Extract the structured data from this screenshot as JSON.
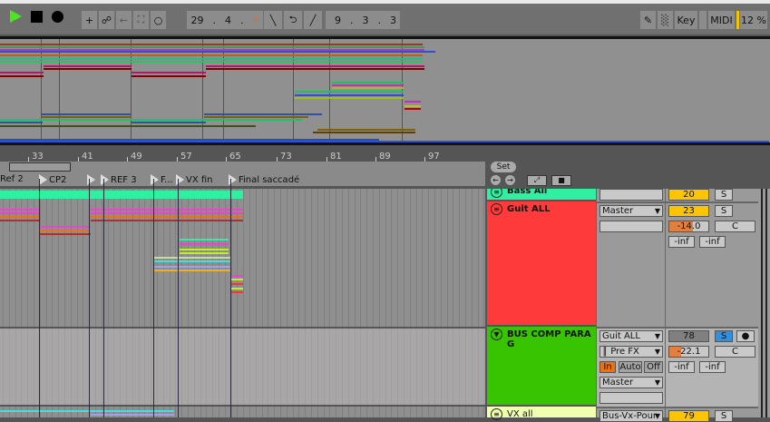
{
  "transport": {
    "play": "play-icon",
    "stop": "stop-icon",
    "record": "record-icon"
  },
  "position": {
    "bar": "29",
    "beat": "4",
    "sixteenth": "4"
  },
  "loop_length": {
    "bar": "9",
    "beat": "3",
    "sixteenth": "3"
  },
  "right_toolbar": {
    "key": "Key",
    "midi": "MIDI",
    "cpu": "12 %"
  },
  "ruler": {
    "bars": [
      "33",
      "41",
      "49",
      "57",
      "65",
      "73",
      "81",
      "89",
      "97"
    ]
  },
  "locators": [
    "Ref 2",
    "CP2",
    "",
    "REF 3",
    "F...",
    "VX fin",
    "Final saccadé"
  ],
  "set_panel": {
    "set": "Set"
  },
  "tracks": [
    {
      "name": "Bass All",
      "color": "#2ef0a0",
      "volume": "20",
      "solo": "S"
    },
    {
      "name": "Guit ALL",
      "color": "#ff3a3a",
      "output": "Master",
      "volume": "23",
      "solo": "S",
      "send": "-14.0",
      "pan": "C",
      "peak_l": "-inf",
      "peak_r": "-inf"
    },
    {
      "name": "BUS COMP PARA G",
      "color": "#38c400",
      "input": "Guit ALL",
      "input_ch": "Pre FX",
      "monitor": [
        "In",
        "Auto",
        "Off"
      ],
      "output": "Master",
      "volume": "78",
      "solo": "S",
      "send": "-22.1",
      "pan": "C",
      "peak_l": "-inf",
      "peak_r": "-inf"
    },
    {
      "name": "VX all",
      "color": "#f0ffb0",
      "output": "Bus-Vx-Pour-",
      "volume": "79",
      "solo": "S"
    }
  ]
}
